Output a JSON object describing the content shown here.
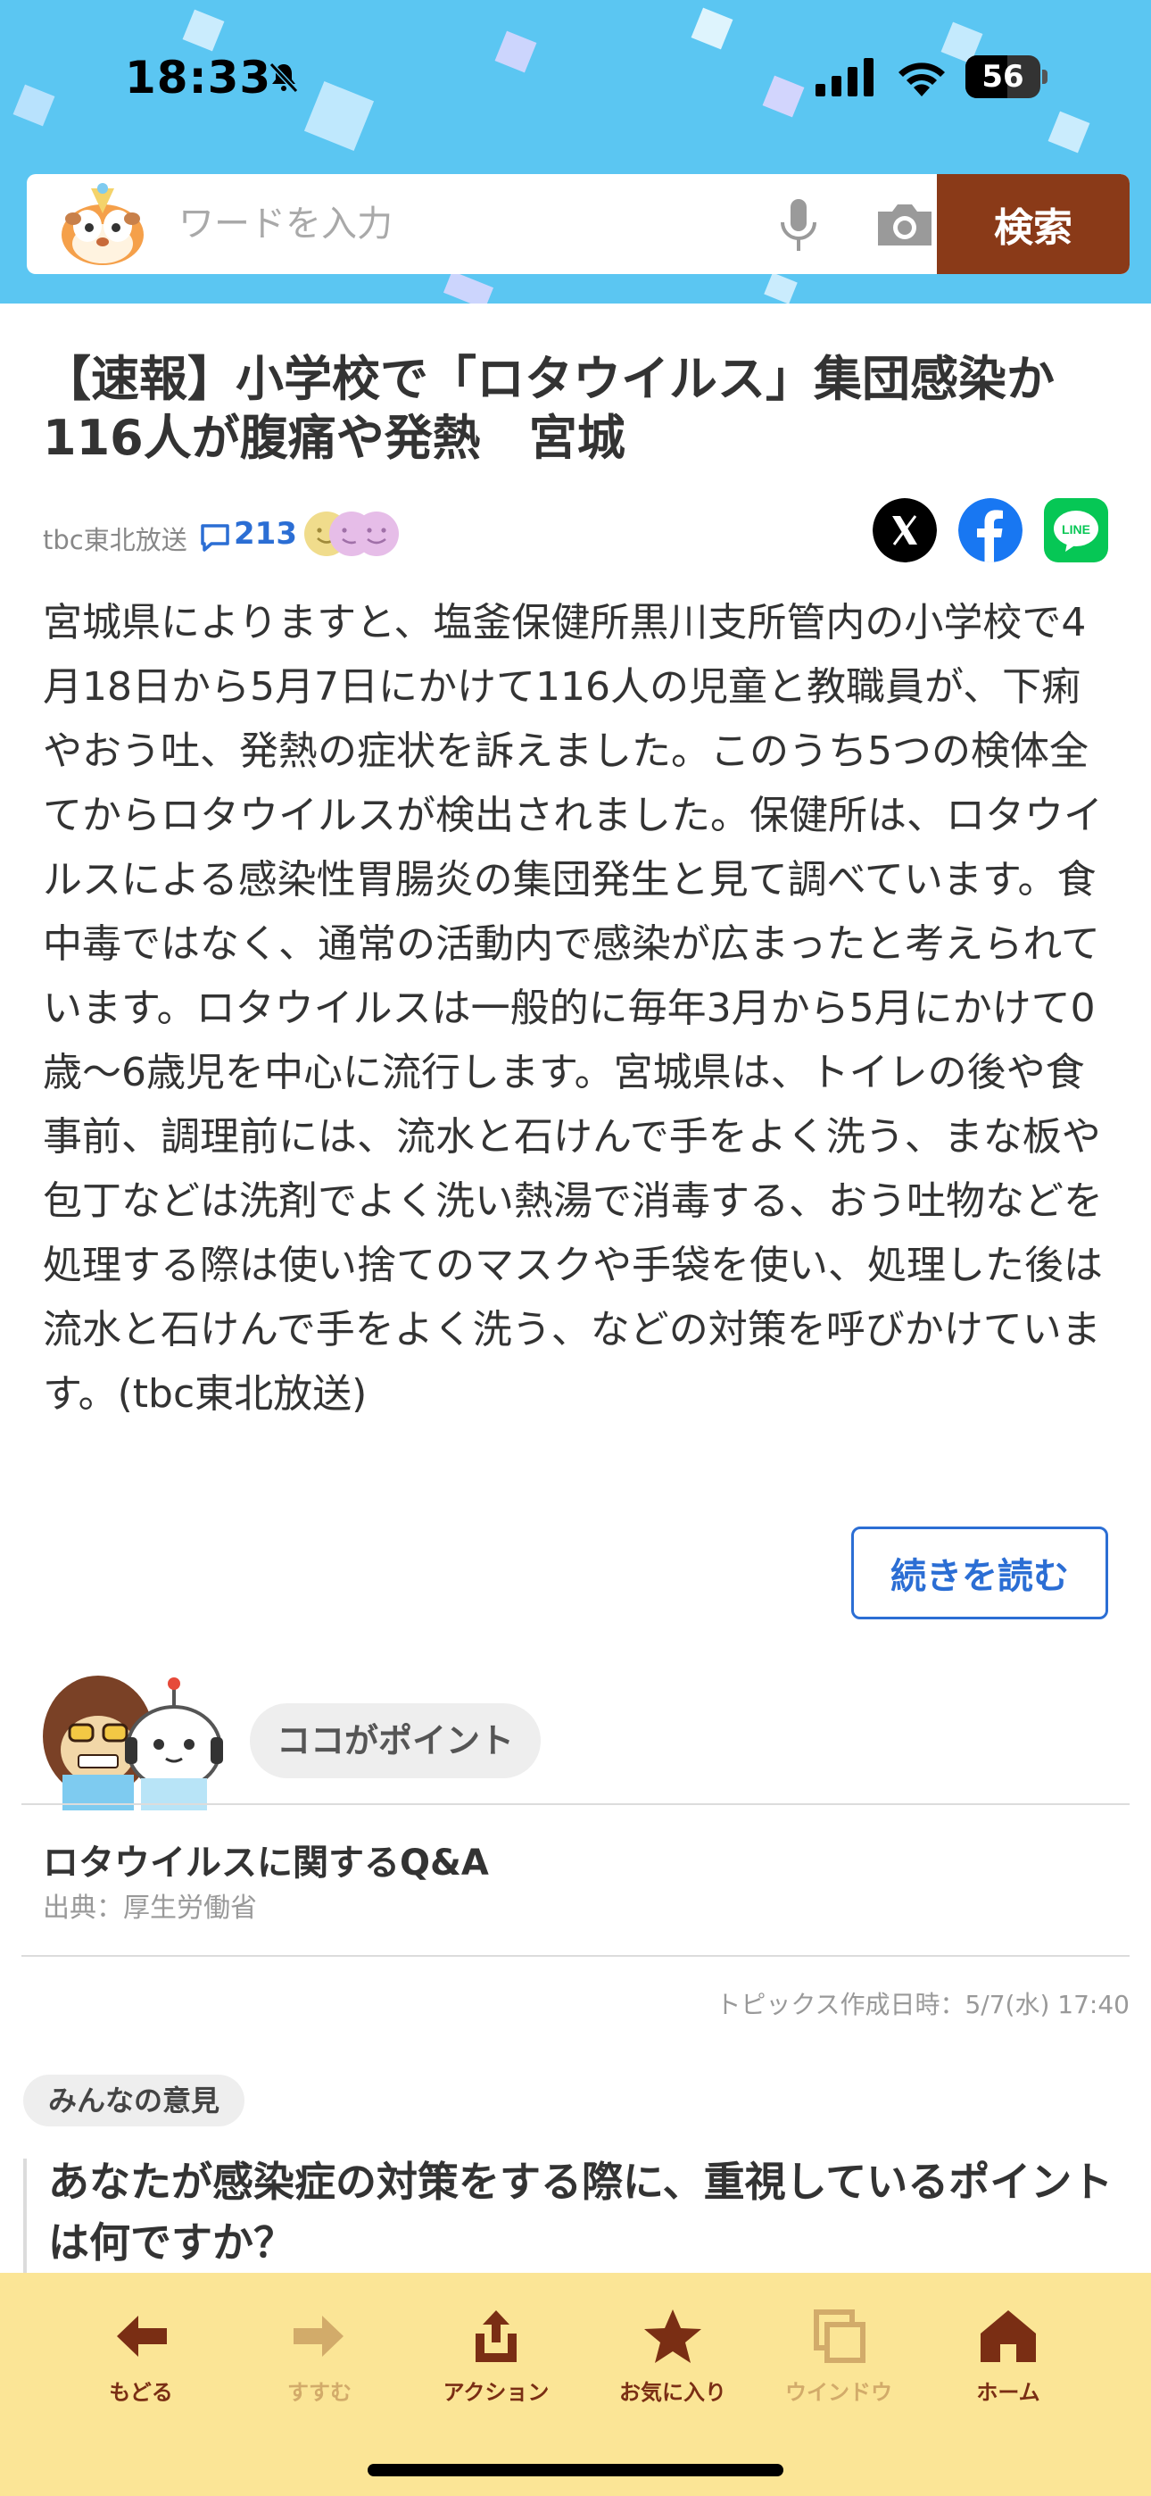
{
  "status": {
    "time": "18:33",
    "battery": "56",
    "battery_level": 0.56
  },
  "search": {
    "placeholder": "ワードを入力",
    "button": "検索"
  },
  "article": {
    "title": "【速報】小学校で「ロタウイルス」集団感染か116人が腹痛や発熱　宮城",
    "source": "tbc東北放送",
    "comment_count": "213",
    "body": "宮城県によりますと、塩釜保健所黒川支所管内の小学校で4月18日から5月7日にかけて116人の児童と教職員が、下痢やおう吐、発熱の症状を訴えました。このうち5つの検体全てからロタウイルスが検出されました。保健所は、ロタウイルスによる感染性胃腸炎の集団発生と見て調べています。食中毒ではなく、通常の活動内で感染が広まったと考えられています。ロタウイルスは一般的に毎年3月から5月にかけて0歳〜6歳児を中心に流行します。宮城県は、トイレの後や食事前、調理前には、流水と石けんで手をよく洗う、まな板や包丁などは洗剤でよく洗い熱湯で消毒する、おう吐物などを処理する際は使い捨てのマスクや手袋を使い、処理した後は流水と石けんで手をよく洗う、などの対策を呼びかけています。(tbc東北放送)",
    "read_more": "続きを読む"
  },
  "point": {
    "label": "ココがポイント",
    "qa_title": "ロタウイルスに関するQ&A",
    "qa_source": "出典：厚生労働省",
    "created": "トピックス作成日時：5/7(水) 17:40"
  },
  "opinion": {
    "badge": "みんなの意見",
    "question": "あなたが感染症の対策をする際に、重視しているポイントは何ですか？"
  },
  "toolbar": {
    "back": "もどる",
    "forward": "すすむ",
    "action": "アクション",
    "favorite": "お気に入り",
    "window": "ウインドウ",
    "home": "ホーム"
  },
  "colors": {
    "header_bg": "#5bc6f2",
    "search_button": "#8a3a18",
    "link_blue": "#2b6ed4",
    "toolbar_bg": "#fbe596",
    "toolbar_icon": "#7a2e14",
    "toolbar_disabled": "#d2ab6a"
  }
}
